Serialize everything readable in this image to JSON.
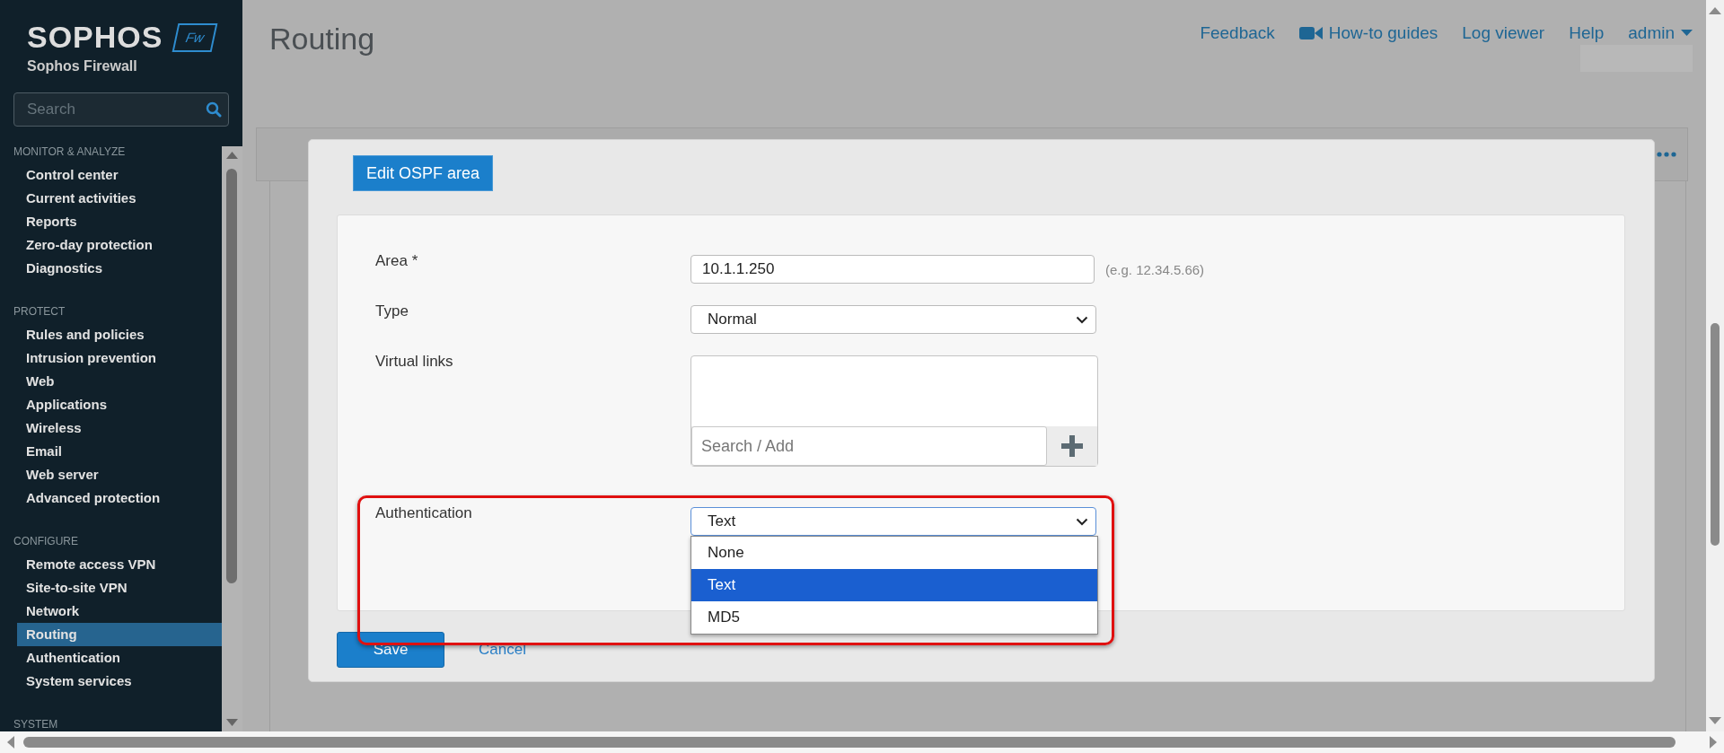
{
  "sidebar": {
    "logo": "SOPHOS",
    "badge": "Fw",
    "product": "Sophos Firewall",
    "search": {
      "placeholder": "Search"
    },
    "sections": [
      {
        "title": "MONITOR & ANALYZE",
        "items": [
          {
            "label": "Control center",
            "selected": false
          },
          {
            "label": "Current activities",
            "selected": false
          },
          {
            "label": "Reports",
            "selected": false
          },
          {
            "label": "Zero-day protection",
            "selected": false
          },
          {
            "label": "Diagnostics",
            "selected": false
          }
        ]
      },
      {
        "title": "PROTECT",
        "items": [
          {
            "label": "Rules and policies",
            "selected": false
          },
          {
            "label": "Intrusion prevention",
            "selected": false
          },
          {
            "label": "Web",
            "selected": false
          },
          {
            "label": "Applications",
            "selected": false
          },
          {
            "label": "Wireless",
            "selected": false
          },
          {
            "label": "Email",
            "selected": false
          },
          {
            "label": "Web server",
            "selected": false
          },
          {
            "label": "Advanced protection",
            "selected": false
          }
        ]
      },
      {
        "title": "CONFIGURE",
        "items": [
          {
            "label": "Remote access VPN",
            "selected": false
          },
          {
            "label": "Site-to-site VPN",
            "selected": false
          },
          {
            "label": "Network",
            "selected": false
          },
          {
            "label": "Routing",
            "selected": true
          },
          {
            "label": "Authentication",
            "selected": false
          },
          {
            "label": "System services",
            "selected": false
          }
        ]
      },
      {
        "title": "SYSTEM"
      }
    ]
  },
  "header": {
    "title": "Routing",
    "links": [
      {
        "kind": "link",
        "label": "Feedback"
      },
      {
        "kind": "video",
        "label": "How-to guides"
      },
      {
        "kind": "link",
        "label": "Log viewer"
      },
      {
        "kind": "link",
        "label": "Help"
      },
      {
        "kind": "menu",
        "label": "admin"
      }
    ]
  },
  "dialog": {
    "title": "Edit OSPF area",
    "fields": [
      {
        "kind": "text",
        "label": "Area *",
        "value": "10.1.1.250",
        "hint": "(e.g. 12.34.5.66)"
      },
      {
        "kind": "select",
        "label": "Type",
        "value": "Normal",
        "expanded": false
      },
      {
        "kind": "list",
        "label": "Virtual links",
        "placeholder": "Search / Add"
      },
      {
        "kind": "select",
        "label": "Authentication",
        "value": "Text",
        "expanded": true,
        "highlighted": true,
        "options": [
          {
            "label": "None",
            "selected": false
          },
          {
            "label": "Text",
            "selected": true
          },
          {
            "label": "MD5",
            "selected": false
          }
        ]
      }
    ],
    "buttons": [
      {
        "kind": "primary",
        "label": "Save"
      },
      {
        "kind": "link",
        "label": "Cancel"
      }
    ]
  }
}
